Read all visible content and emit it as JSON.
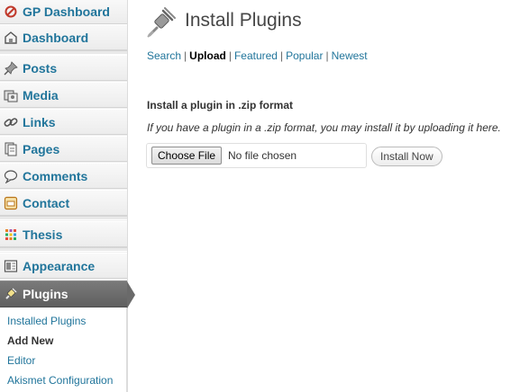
{
  "sidebar": {
    "items": [
      {
        "label": "GP Dashboard",
        "icon": "gp-dashboard-icon"
      },
      {
        "label": "Dashboard",
        "icon": "dashboard-icon"
      },
      {
        "label": "Posts",
        "icon": "posts-pin-icon"
      },
      {
        "label": "Media",
        "icon": "media-icon"
      },
      {
        "label": "Links",
        "icon": "links-icon"
      },
      {
        "label": "Pages",
        "icon": "pages-icon"
      },
      {
        "label": "Comments",
        "icon": "comments-icon"
      },
      {
        "label": "Contact",
        "icon": "contact-icon"
      },
      {
        "label": "Thesis",
        "icon": "thesis-icon"
      },
      {
        "label": "Appearance",
        "icon": "appearance-icon"
      },
      {
        "label": "Plugins",
        "icon": "plugins-icon"
      }
    ],
    "submenu": [
      {
        "label": "Installed Plugins"
      },
      {
        "label": "Add New"
      },
      {
        "label": "Editor"
      },
      {
        "label": "Akismet Configuration"
      }
    ]
  },
  "main": {
    "title": "Install Plugins",
    "tabs": [
      {
        "label": "Search"
      },
      {
        "label": "Upload"
      },
      {
        "label": "Featured"
      },
      {
        "label": "Popular"
      },
      {
        "label": "Newest"
      }
    ],
    "tab_separator": "|",
    "section_heading": "Install a plugin in .zip format",
    "description": "If you have a plugin in a .zip format, you may install it by uploading it here.",
    "choose_file_label": "Choose File",
    "file_status": "No file chosen",
    "install_button": "Install Now"
  },
  "colors": {
    "link": "#21759b",
    "active_menu": "#6a6a6a",
    "sidebar_bg": "#f1f1f1"
  }
}
